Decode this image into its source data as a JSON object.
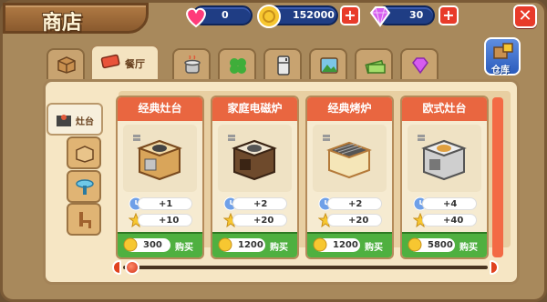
{
  "title": "商店",
  "currencies": {
    "hearts": {
      "value": "0",
      "icon": "heart-icon"
    },
    "coins": {
      "value": "152000",
      "icon": "coin-icon"
    },
    "gems": {
      "value": "30",
      "icon": "gem-icon"
    }
  },
  "tabs": [
    {
      "name": "box",
      "label": ""
    },
    {
      "name": "restaurant",
      "label": "餐厅"
    },
    {
      "name": "pot",
      "label": ""
    },
    {
      "name": "clover",
      "label": ""
    },
    {
      "name": "fridge",
      "label": ""
    },
    {
      "name": "landscape",
      "label": ""
    },
    {
      "name": "money",
      "label": ""
    },
    {
      "name": "diamond",
      "label": ""
    }
  ],
  "warehouse_label": "仓库",
  "sidebar": [
    {
      "name": "stove",
      "label": "灶台"
    },
    {
      "name": "cabinet",
      "label": ""
    },
    {
      "name": "table",
      "label": ""
    },
    {
      "name": "chair",
      "label": ""
    }
  ],
  "items": [
    {
      "name": "经典灶台",
      "stat1": "+1",
      "stat2": "+10",
      "price": "300",
      "buy": "购买"
    },
    {
      "name": "家庭电磁炉",
      "stat1": "+2",
      "stat2": "+20",
      "price": "1200",
      "buy": "购买"
    },
    {
      "name": "经典烤炉",
      "stat1": "+2",
      "stat2": "+20",
      "price": "1200",
      "buy": "购买"
    },
    {
      "name": "欧式灶台",
      "stat1": "+4",
      "stat2": "+40",
      "price": "5800",
      "buy": "购买"
    }
  ],
  "colors": {
    "accent": "#e96640",
    "buy": "#4fb040",
    "currency_bar": "#1f3d84"
  }
}
